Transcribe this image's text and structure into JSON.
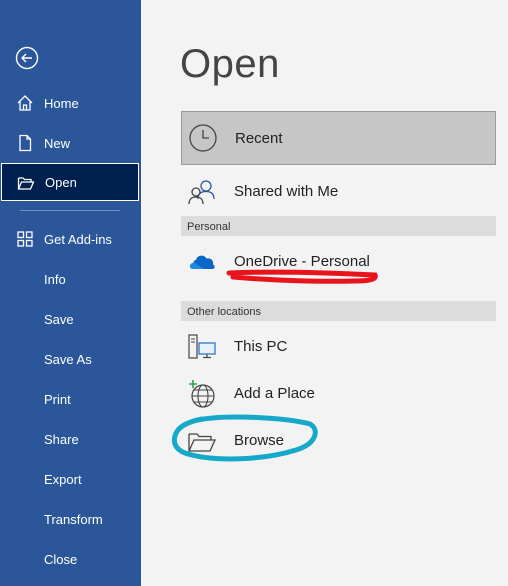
{
  "sidebar": {
    "items": [
      {
        "label": "Home",
        "icon": "home-icon"
      },
      {
        "label": "New",
        "icon": "new-document-icon"
      },
      {
        "label": "Open",
        "icon": "open-folder-icon",
        "active": true
      },
      {
        "label": "Get Add-ins",
        "icon": "add-ins-icon"
      },
      {
        "label": "Info"
      },
      {
        "label": "Save"
      },
      {
        "label": "Save As"
      },
      {
        "label": "Print"
      },
      {
        "label": "Share"
      },
      {
        "label": "Export"
      },
      {
        "label": "Transform"
      },
      {
        "label": "Close"
      }
    ]
  },
  "main": {
    "title": "Open",
    "locations": {
      "recent": "Recent",
      "shared": "Shared with Me",
      "personal_header": "Personal",
      "onedrive": "OneDrive - Personal",
      "other_header": "Other locations",
      "this_pc": "This PC",
      "add_place": "Add a Place",
      "browse": "Browse"
    }
  },
  "colors": {
    "sidebar_bg": "#2b579a",
    "sidebar_active": "#002050",
    "annotation_red": "#e8141b",
    "annotation_cyan": "#16a8c8"
  }
}
